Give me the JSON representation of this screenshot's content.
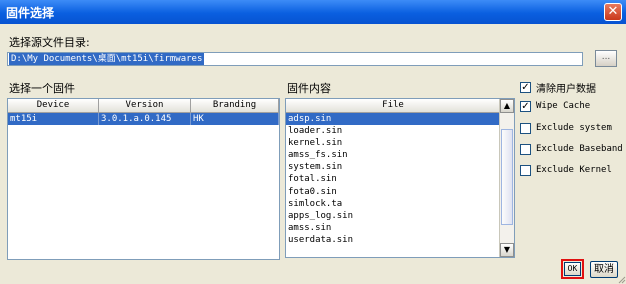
{
  "window": {
    "title": "固件选择",
    "close_icon": "close-icon"
  },
  "path_section": {
    "label": "选择源文件目录:",
    "path_value": "D:\\My Documents\\桌面\\mt15i\\firmwares",
    "browse_label": "..."
  },
  "device_section": {
    "label": "选择一个固件",
    "columns": [
      "Device",
      "Version",
      "Branding"
    ],
    "rows": [
      {
        "device": "mt15i",
        "version": "3.0.1.a.0.145",
        "branding": "HK"
      }
    ]
  },
  "content_section": {
    "label": "固件内容",
    "column": "File",
    "files": [
      "adsp.sin",
      "loader.sin",
      "kernel.sin",
      "amss_fs.sin",
      "system.sin",
      "fotal.sin",
      "fota0.sin",
      "simlock.ta",
      "apps_log.sin",
      "amss.sin",
      "userdata.sin"
    ],
    "selected_index": 0
  },
  "options": [
    {
      "label": "清除用户数据",
      "checked": true
    },
    {
      "label": "Wipe Cache",
      "checked": true
    },
    {
      "label": "Exclude system",
      "checked": false
    },
    {
      "label": "Exclude Baseband",
      "checked": false
    },
    {
      "label": "Exclude Kernel",
      "checked": false
    }
  ],
  "buttons": {
    "ok": "OK",
    "cancel": "取消"
  },
  "colors": {
    "titlebar": "#0a5fe0",
    "selection": "#316ac5",
    "dialog_bg": "#ece9d8",
    "highlight_box": "#e01010"
  }
}
